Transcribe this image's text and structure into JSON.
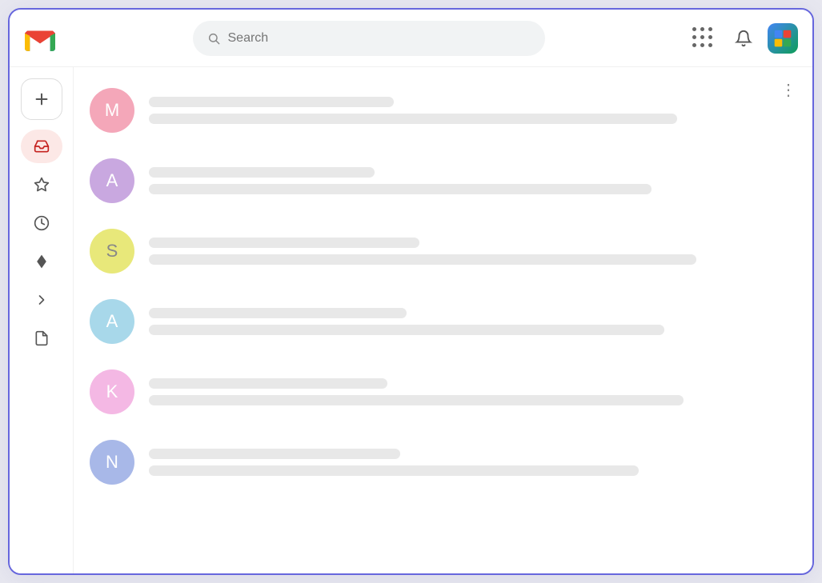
{
  "header": {
    "logo_label": "Gmail",
    "search_placeholder": "Search",
    "apps_icon_label": "Google apps",
    "notifications_icon_label": "Notifications",
    "profile_icon_label": "Profile"
  },
  "sidebar": {
    "compose_label": "+",
    "items": [
      {
        "id": "inbox",
        "icon": "inbox",
        "label": "Inbox",
        "active": true
      },
      {
        "id": "starred",
        "icon": "star",
        "label": "Starred",
        "active": false
      },
      {
        "id": "snoozed",
        "icon": "clock",
        "label": "Snoozed",
        "active": false
      },
      {
        "id": "important",
        "icon": "label",
        "label": "Important",
        "active": false
      },
      {
        "id": "sent",
        "icon": "sent",
        "label": "Sent",
        "active": false
      },
      {
        "id": "drafts",
        "icon": "file",
        "label": "Drafts",
        "active": false
      }
    ]
  },
  "emails": [
    {
      "id": 1,
      "initial": "M",
      "color": "#f4a7b9"
    },
    {
      "id": 2,
      "initial": "A",
      "color": "#c9a8e0"
    },
    {
      "id": 3,
      "initial": "S",
      "color": "#e8e87a"
    },
    {
      "id": 4,
      "initial": "A",
      "color": "#a8d8ea"
    },
    {
      "id": 5,
      "initial": "K",
      "color": "#f4b8e4"
    },
    {
      "id": 6,
      "initial": "N",
      "color": "#a8b8e8"
    }
  ],
  "more_options_label": "⋮"
}
